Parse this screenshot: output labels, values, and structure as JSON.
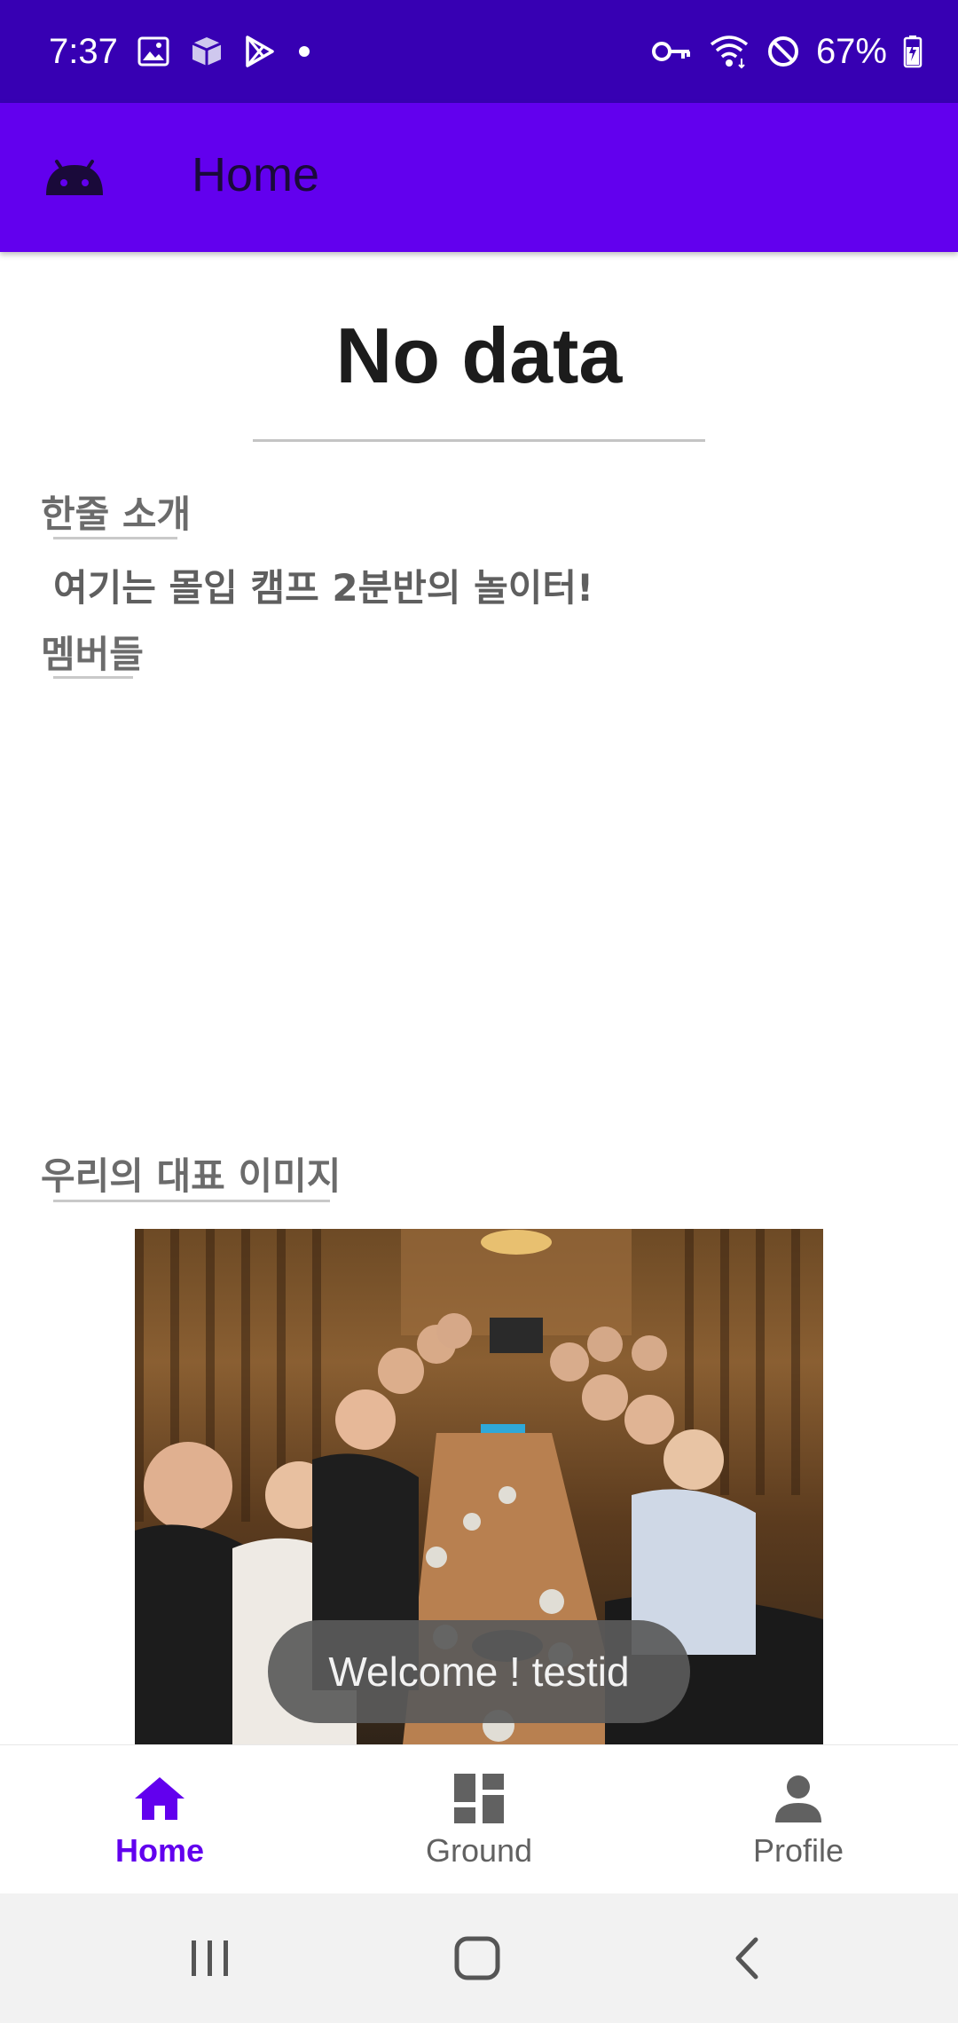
{
  "status_bar": {
    "time": "7:37",
    "left_icons": [
      "image-icon",
      "package-icon",
      "play-store-icon",
      "dot-icon"
    ],
    "right_icons": [
      "vpn-key-icon",
      "wifi-icon",
      "do-not-disturb-icon"
    ],
    "battery": "67%"
  },
  "app_bar": {
    "title": "Home",
    "logo": "android-icon"
  },
  "main": {
    "headline": "No data",
    "intro_title": "한줄 소개",
    "intro_text": "여기는 몰입 캠프 2분반의 놀이터!",
    "members_title": "멤버들",
    "image_title": "우리의 대표 이미지"
  },
  "toast": {
    "text": "Welcome ! testid"
  },
  "bottom_nav": {
    "items": [
      {
        "label": "Home",
        "icon": "home-icon",
        "active": true
      },
      {
        "label": "Ground",
        "icon": "dashboard-icon",
        "active": false
      },
      {
        "label": "Profile",
        "icon": "person-icon",
        "active": false
      }
    ]
  },
  "colors": {
    "status_bar": "#3700b3",
    "app_bar": "#6200ee",
    "accent": "#6200ee",
    "inactive": "#616161"
  }
}
